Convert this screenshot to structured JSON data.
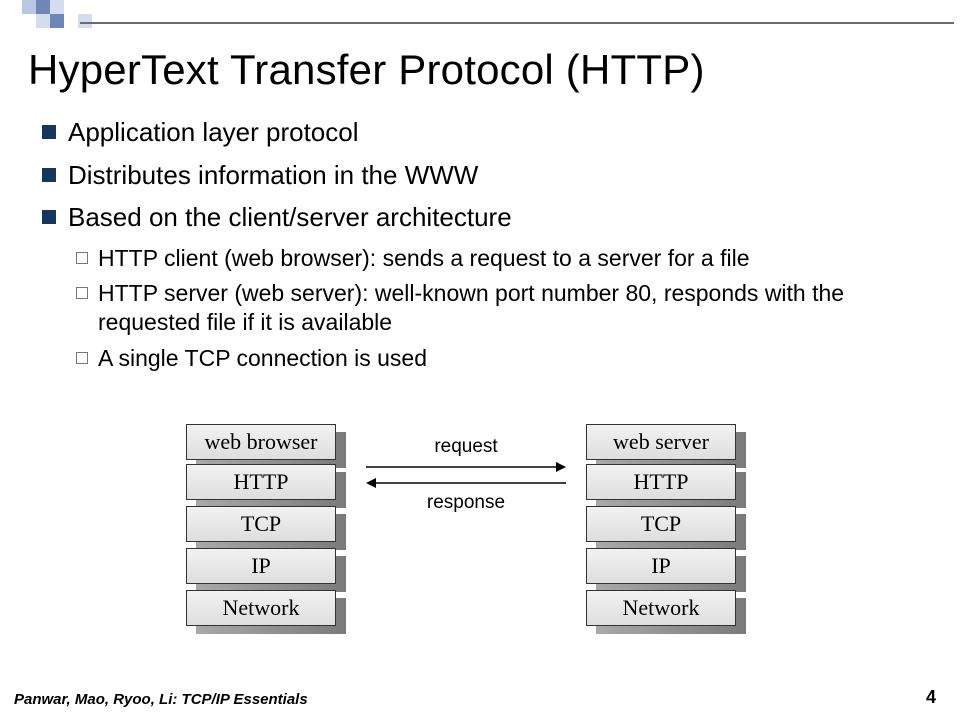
{
  "title": "HyperText Transfer Protocol (HTTP)",
  "bullets": {
    "b1": "Application layer protocol",
    "b2": "Distributes information in the WWW",
    "b3": "Based on the client/server architecture",
    "sub1": "HTTP client (web browser): sends a request to a server for a file",
    "sub2": "HTTP server (web server): well-known port number 80, responds with the requested file if it is available",
    "sub3": "A single TCP connection is used"
  },
  "diagram": {
    "left_stack": {
      "l0": "web browser",
      "l1": "HTTP",
      "l2": "TCP",
      "l3": "IP",
      "l4": "Network"
    },
    "right_stack": {
      "l0": "web server",
      "l1": "HTTP",
      "l2": "TCP",
      "l3": "IP",
      "l4": "Network"
    },
    "arrow_top": "request",
    "arrow_bottom": "response"
  },
  "footer": "Panwar, Mao, Ryoo, Li: TCP/IP Essentials",
  "page": "4"
}
